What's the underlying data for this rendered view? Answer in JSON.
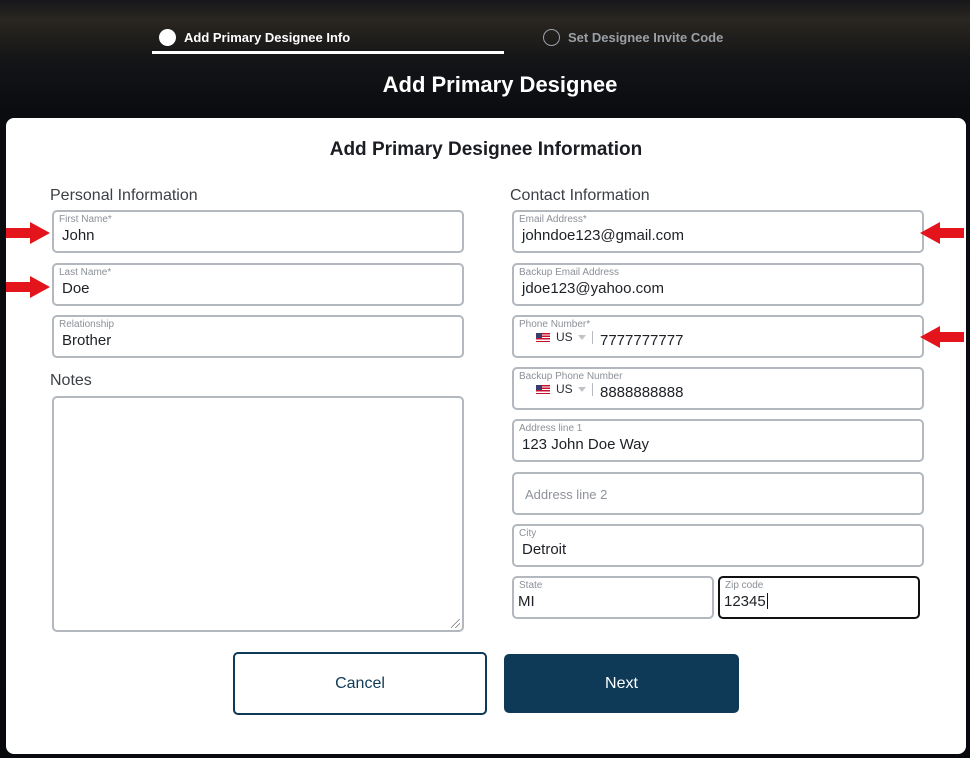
{
  "stepper": {
    "steps": [
      {
        "label": "Add Primary Designee Info",
        "active": true
      },
      {
        "label": "Set Designee Invite Code",
        "active": false
      }
    ]
  },
  "page_title": "Add Primary Designee",
  "card_title": "Add Primary Designee Information",
  "personal": {
    "section_label": "Personal Information",
    "first_name": {
      "label": "First Name*",
      "value": "John"
    },
    "last_name": {
      "label": "Last Name*",
      "value": "Doe"
    },
    "relationship": {
      "label": "Relationship",
      "value": "Brother"
    },
    "notes_label": "Notes",
    "notes_value": ""
  },
  "contact": {
    "section_label": "Contact Information",
    "email": {
      "label": "Email Address*",
      "value": "johndoe123@gmail.com"
    },
    "backup_email": {
      "label": "Backup Email Address",
      "value": "jdoe123@yahoo.com"
    },
    "phone": {
      "label": "Phone Number*",
      "country": "US",
      "value": "7777777777"
    },
    "backup_phone": {
      "label": "Backup Phone Number",
      "country": "US",
      "value": "8888888888"
    },
    "address1": {
      "label": "Address line 1",
      "value": "123 John Doe Way"
    },
    "address2": {
      "placeholder": "Address line 2"
    },
    "city": {
      "label": "City",
      "value": "Detroit"
    },
    "state": {
      "label": "State",
      "value": "MI"
    },
    "zip": {
      "label": "Zip code",
      "value": "12345"
    }
  },
  "buttons": {
    "cancel": "Cancel",
    "next": "Next"
  },
  "colors": {
    "primary": "#0e3a57",
    "annotation_arrow": "#e3141b",
    "field_border": "#b3b8bf"
  },
  "icons": [
    "us-flag-icon",
    "chevron-down-icon",
    "arrow-annotation-icon",
    "resize-grip-icon"
  ]
}
